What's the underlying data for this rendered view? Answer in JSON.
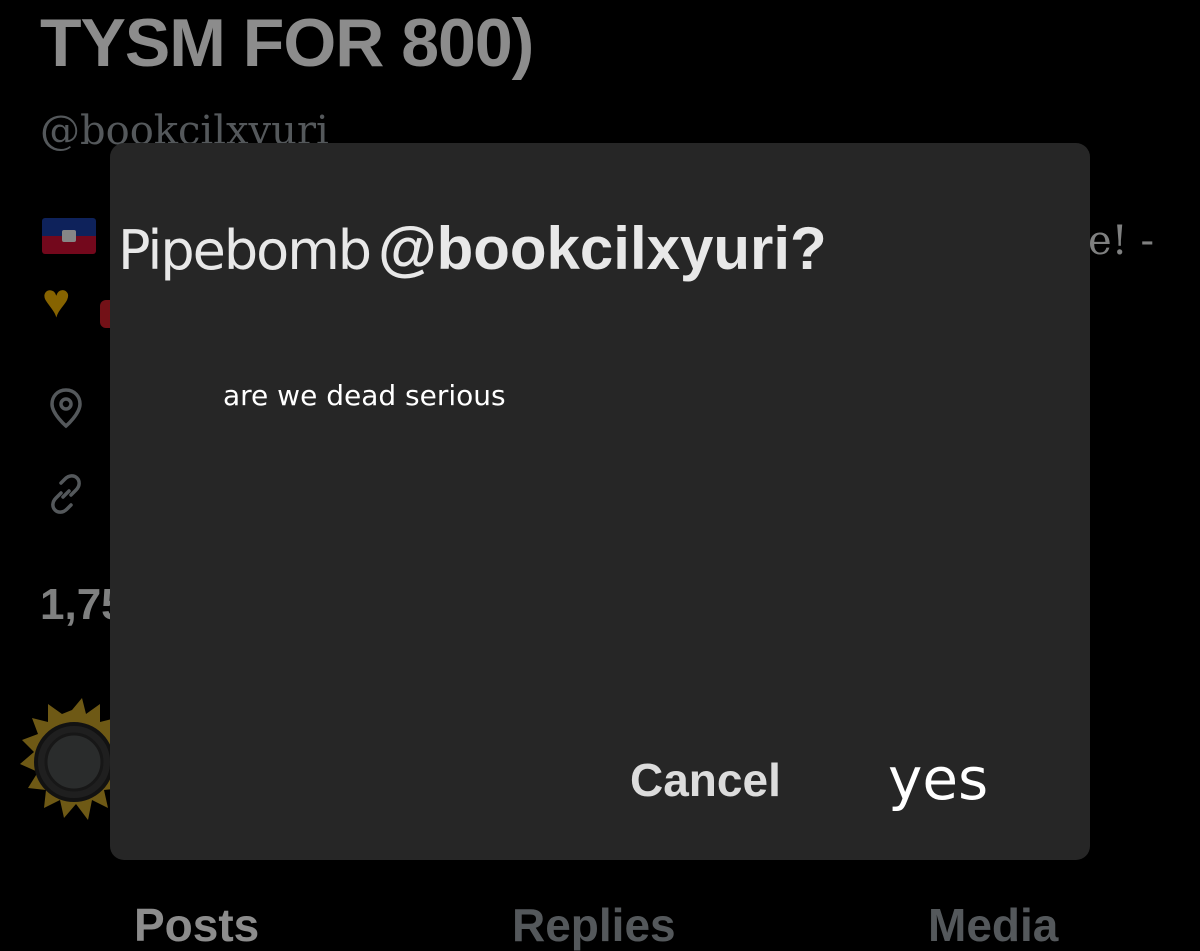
{
  "profile": {
    "display_name": "TYSM FOR 800)",
    "handle": "@bookcilxyuri",
    "bio_tail": "e! -",
    "stat_count": "1,75",
    "icons": {
      "flag": "haiti-flag-icon",
      "heart": "yellow-heart-icon",
      "location": "location-pin-icon",
      "link": "link-icon",
      "badge": "pipebomb-badge-icon"
    }
  },
  "tabs": [
    {
      "label": "Posts"
    },
    {
      "label": "Replies"
    },
    {
      "label": "Media"
    }
  ],
  "dialog": {
    "title_prefix": "Pipebomb",
    "title_handle": "@bookcilxyuri?",
    "message": "are we dead serious",
    "cancel_label": "Cancel",
    "confirm_label": "yes"
  },
  "colors": {
    "background": "#000000",
    "dialog_bg": "#262626",
    "muted_text": "#9aa0a6",
    "heart": "#f5b400"
  }
}
